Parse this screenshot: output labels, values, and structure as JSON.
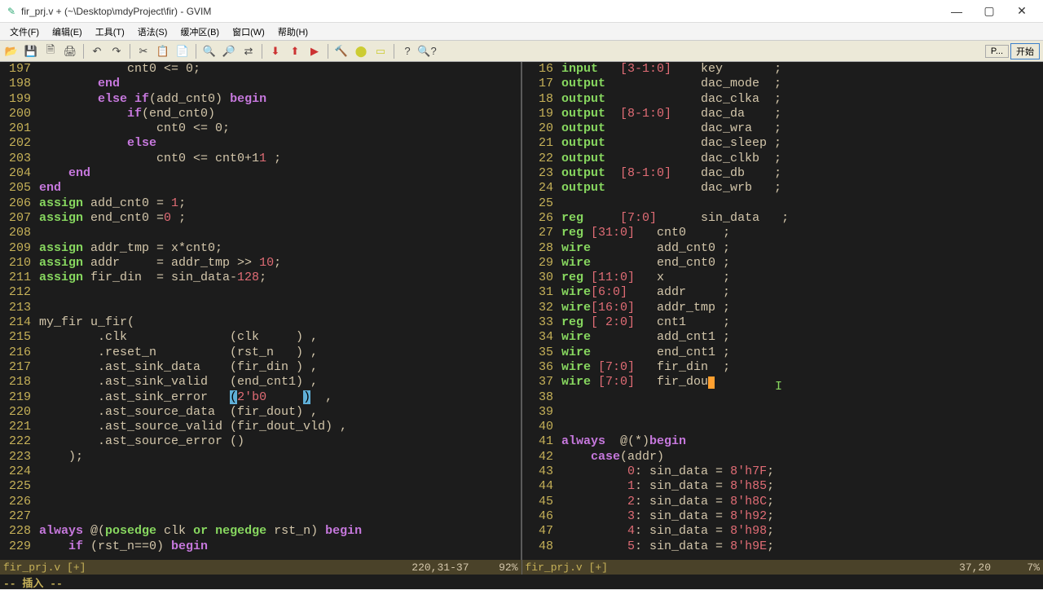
{
  "window": {
    "title": "fir_prj.v + (~\\Desktop\\mdyProject\\fir) - GVIM",
    "min": "—",
    "max": "▢",
    "close": "✕"
  },
  "menu": [
    "文件(F)",
    "编辑(E)",
    "工具(T)",
    "语法(S)",
    "缓冲区(B)",
    "窗口(W)",
    "帮助(H)"
  ],
  "rtool": {
    "p": "P...",
    "start": "开始"
  },
  "left": {
    "lines": [
      "197",
      "198",
      "199",
      "200",
      "201",
      "202",
      "203",
      "204",
      "205",
      "206",
      "207",
      "208",
      "209",
      "210",
      "211",
      "212",
      "213",
      "214",
      "215",
      "216",
      "217",
      "218",
      "219",
      "220",
      "221",
      "222",
      "223",
      "224",
      "225",
      "226",
      "227",
      "228",
      "229"
    ],
    "t197": "            cnt0 <= 0;",
    "t198": "        end",
    "t199a": "        else if",
    "t199b": "(add_cnt0) ",
    "t199c": "begin",
    "t200": "            if(end_cnt0)",
    "t201": "                cnt0 <= 0;",
    "t202": "            else",
    "t203": "                cnt0 <= cnt0+1 ;",
    "t204": "    end",
    "t205": "end",
    "t206a": "assign",
    "t206b": " add_cnt0 = 1;",
    "t207a": "assign",
    "t207b": " end_cnt0 = 0 ;",
    "t208": "",
    "t209a": "assign",
    "t209b": " addr_tmp = x*cnt0;",
    "t210a": "assign",
    "t210b": " addr     = addr_tmp >> 10;",
    "t211a": "assign",
    "t211b": " fir_din  = sin_data-128;",
    "t212": "",
    "t213": "",
    "t214": "my_fir u_fir(",
    "t215": "        .clk              (clk     ) ,",
    "t216": "        .reset_n          (rst_n   ) ,",
    "t217": "        .ast_sink_data    (fir_din ) ,",
    "t218": "        .ast_sink_valid   (end_cnt1) ,",
    "t219a": "        .ast_sink_error   ",
    "t219b": "(",
    "t219c": "2'b0     ",
    "t219d": ")",
    "t219e": "  ,",
    "t220": "        .ast_source_data  (fir_dout) ,",
    "t221": "        .ast_source_valid (fir_dout_vld) ,",
    "t222": "        .ast_source_error ()",
    "t223": "    );",
    "t224": "",
    "t225": "",
    "t226": "",
    "t227": "",
    "t228a": "always",
    "t228b": " @(",
    "t228c": "posedge",
    "t228d": " clk ",
    "t228e": "or negedge",
    "t228f": " rst_n) ",
    "t228g": "begin",
    "t229a": "    if",
    "t229b": " (rst_n==0) ",
    "t229c": "begin"
  },
  "right": {
    "lines": [
      "16",
      "17",
      "18",
      "19",
      "20",
      "21",
      "22",
      "23",
      "24",
      "25",
      "26",
      "27",
      "28",
      "29",
      "30",
      "31",
      "32",
      "33",
      "34",
      "35",
      "36",
      "37",
      "38",
      "39",
      "40",
      "41",
      "42",
      "43",
      "44",
      "45",
      "46",
      "47",
      "48"
    ],
    "r16": "input   [3-1:0]    key       ;",
    "r17": "output             dac_mode  ;",
    "r18": "output             dac_clka  ;",
    "r19": "output  [8-1:0]    dac_da    ;",
    "r20": "output             dac_wra   ;",
    "r21": "output             dac_sleep ;",
    "r22": "output             dac_clkb  ;",
    "r23": "output  [8-1:0]    dac_db    ;",
    "r24": "output             dac_wrb   ;",
    "r25": "",
    "r26": "reg     [7:0]      sin_data   ;",
    "r27": "reg [31:0]   cnt0     ;",
    "r28": "wire         add_cnt0 ;",
    "r29": "wire         end_cnt0 ;",
    "r30": "reg [11:0]   x        ;",
    "r31": "wire[6:0]    addr     ;",
    "r32": "wire[16:0]   addr_tmp ;",
    "r33": "reg [ 2:0]   cnt1     ;",
    "r34": "wire         add_cnt1 ;",
    "r35": "wire         end_cnt1 ;",
    "r36": "wire [7:0]   fir_din  ;",
    "r37a": "wire [7:0]   fir_dou",
    "r37b": "",
    "r38": "",
    "r39": "",
    "r40": "",
    "r41a": "always",
    "r41b": "  @(",
    "r41c": "*",
    "r41d": ")",
    "r41e": "begin",
    "r42a": "    case",
    "r42b": "(addr)",
    "r43": "         0: sin_data = 8'h7F;",
    "r44": "         1: sin_data = 8'h85;",
    "r45": "         2: sin_data = 8'h8C;",
    "r46": "         3: sin_data = 8'h92;",
    "r47": "         4: sin_data = 8'h98;",
    "r48": "         5: sin_data = 8'h9E;"
  },
  "statusL": {
    "file": "fir_prj.v [+]",
    "pos": "220,31-37",
    "pct": "92%"
  },
  "statusR": {
    "file": "fir_prj.v [+]",
    "pos": "37,20",
    "pct": "7%"
  },
  "mode": "-- 插入 --",
  "greencur": "I"
}
